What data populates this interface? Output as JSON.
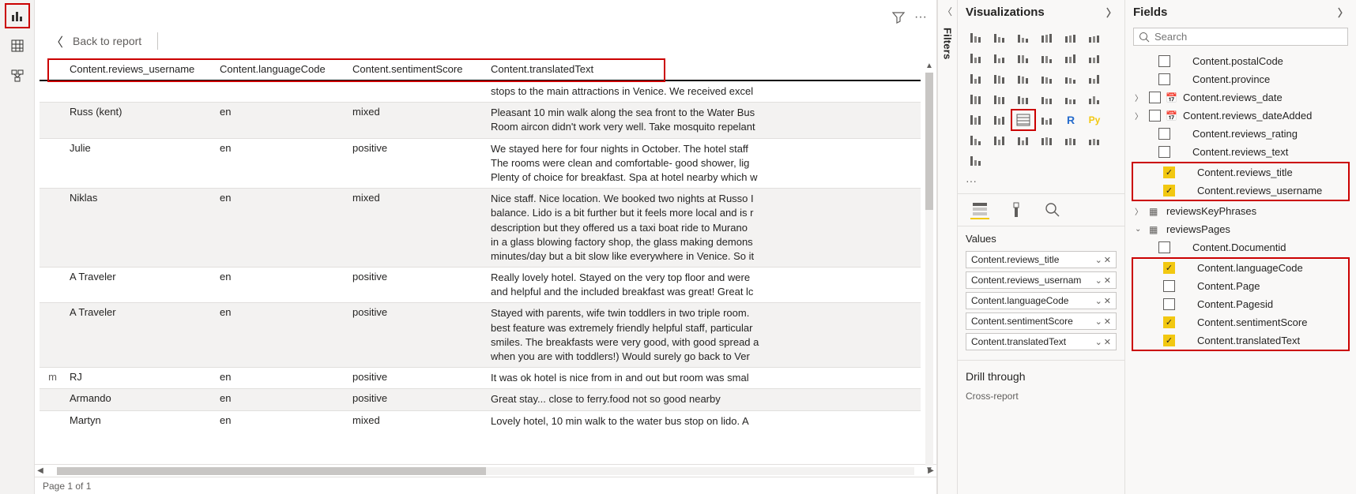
{
  "back_label": "Back to report",
  "status": "Page 1 of 1",
  "filters_label": "Filters",
  "panes": {
    "viz": "Visualizations",
    "fields": "Fields",
    "values": "Values",
    "drill": "Drill through",
    "cross": "Cross-report"
  },
  "search_placeholder": "Search",
  "headers": [
    "Content.reviews_username",
    "Content.languageCode",
    "Content.sentimentScore",
    "Content.translatedText"
  ],
  "rows": [
    {
      "left": "",
      "user": "",
      "lang": "",
      "sent": "",
      "text": "stops to the main attractions in Venice. We received excel"
    },
    {
      "left": "",
      "user": "Russ (kent)",
      "lang": "en",
      "sent": "mixed",
      "text": "Pleasant 10 min walk along the sea front to the Water Bus\nRoom aircon didn't work very well. Take mosquito repelant"
    },
    {
      "left": "",
      "user": "Julie",
      "lang": "en",
      "sent": "positive",
      "text": "We stayed here for four nights in October. The hotel staff\nThe rooms were clean and comfortable- good shower, lig\nPlenty of choice for breakfast. Spa at hotel nearby which w"
    },
    {
      "left": "",
      "user": "Niklas",
      "lang": "en",
      "sent": "mixed",
      "text": "Nice staff. Nice location. We booked two nights at Russo I\nbalance. Lido is a bit further but it feels more local and is r\ndescription but they offered us a taxi boat ride to Murano\nin a glass blowing factory shop, the glass making demons\nminutes/day but a bit slow like everywhere in Venice. So it"
    },
    {
      "left": "",
      "user": "A Traveler",
      "lang": "en",
      "sent": "positive",
      "text": "Really lovely hotel. Stayed on the very top floor and were\nand helpful and the included breakfast was great! Great lc"
    },
    {
      "left": "",
      "user": "A Traveler",
      "lang": "en",
      "sent": "positive",
      "text": "Stayed with parents, wife twin toddlers in two triple room.\nbest feature was extremely friendly helpful staff, particular\nsmiles. The breakfasts were very good, with good spread a\nwhen you are with toddlers!) Would surely go back to Ver"
    },
    {
      "left": "m",
      "user": "RJ",
      "lang": "en",
      "sent": "positive",
      "text": "It was ok hotel is nice from in and out but room was smal"
    },
    {
      "left": "",
      "user": "Armando",
      "lang": "en",
      "sent": "positive",
      "text": "Great stay... close to ferry.food not so good nearby"
    },
    {
      "left": "",
      "user": "Martyn",
      "lang": "en",
      "sent": "mixed",
      "text": "Lovely hotel, 10 min walk to the water bus stop on lido. A"
    }
  ],
  "value_wells": [
    "Content.reviews_title",
    "Content.reviews_usernam",
    "Content.languageCode",
    "Content.sentimentScore",
    "Content.translatedText"
  ],
  "fields_tree": {
    "plain": [
      "Content.postalCode",
      "Content.province"
    ],
    "dates": [
      "Content.reviews_date",
      "Content.reviews_dateAdded"
    ],
    "after_dates": [
      "Content.reviews_rating",
      "Content.reviews_text"
    ],
    "checked_group1": [
      "Content.reviews_title",
      "Content.reviews_username"
    ],
    "table1": "reviewsKeyPhrases",
    "table2": "reviewsPages",
    "pages_first": "Content.Documentid",
    "pages_group": [
      {
        "name": "Content.languageCode",
        "checked": true
      },
      {
        "name": "Content.Page",
        "checked": false
      },
      {
        "name": "Content.Pagesid",
        "checked": false
      },
      {
        "name": "Content.sentimentScore",
        "checked": true
      },
      {
        "name": "Content.translatedText",
        "checked": true
      }
    ]
  }
}
